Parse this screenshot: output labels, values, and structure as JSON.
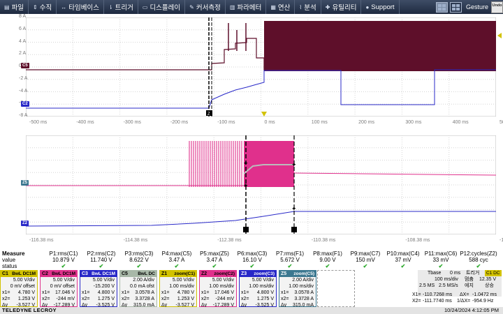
{
  "menu": {
    "items": [
      {
        "icon": "file-icon",
        "glyph": "▤",
        "label": "파일"
      },
      {
        "icon": "vertical-icon",
        "glyph": "⇕",
        "label": "수직"
      },
      {
        "icon": "timebase-icon",
        "glyph": "↔",
        "label": "타임베이스"
      },
      {
        "icon": "trigger-icon",
        "glyph": "⇂",
        "label": "트리거"
      },
      {
        "icon": "display-icon",
        "glyph": "▭",
        "label": "디스플레이"
      },
      {
        "icon": "cursor-icon",
        "glyph": "✎",
        "label": "커서측정"
      },
      {
        "icon": "parameter-icon",
        "glyph": "▥",
        "label": "파라메터"
      },
      {
        "icon": "math-icon",
        "glyph": "▦",
        "label": "연산"
      },
      {
        "icon": "analysis-icon",
        "glyph": "⌇",
        "label": "분석"
      },
      {
        "icon": "utility-icon",
        "glyph": "✚",
        "label": "유틸리티"
      },
      {
        "icon": "support-icon",
        "glyph": "●",
        "label": "Support"
      }
    ],
    "gesture_label": "Gesture",
    "undo_label": "Undo"
  },
  "grid1": {
    "y_labels": [
      "8 A",
      "6 A",
      "4 A",
      "2 A",
      "0 A",
      "-2 A",
      "-4 A",
      "-6 A",
      "-8 A"
    ],
    "x_labels": [
      "-500 ms",
      "-400 ms",
      "-300 ms",
      "-200 ms",
      "-100 ms",
      "0 ms",
      "100 ms",
      "200 ms",
      "300 ms",
      "400 ms",
      "500 ms"
    ],
    "c5_tag": "C5",
    "c2_tag": "C2",
    "cursor_tag": "Z"
  },
  "grid2": {
    "x_labels": [
      "-116.38 ms",
      "-114.38 ms",
      "-112.38 ms",
      "-110.38 ms",
      "-108.38 ms",
      "-106.38 ms"
    ],
    "z5_tag": "Z5",
    "z2_tag": "Z2"
  },
  "measure": {
    "title": "Measure",
    "row_value": "value",
    "row_status": "status",
    "cols": [
      {
        "name": "P1:rms(C1)",
        "value": "10.879 V"
      },
      {
        "name": "P2:rms(C2)",
        "value": "11.740 V"
      },
      {
        "name": "P3:rms(C3)",
        "value": "8.622 V"
      },
      {
        "name": "P4:max(C5)",
        "value": "3.47 A"
      },
      {
        "name": "P5:max(Z5)",
        "value": "3.47 A"
      },
      {
        "name": "P6:max(C3)",
        "value": "16.10 V"
      },
      {
        "name": "P7:rms(F1)",
        "value": "5.672 V"
      },
      {
        "name": "P8:max(F1)",
        "value": "9.00 V"
      },
      {
        "name": "P9:max(C7)",
        "value": "150 mV"
      },
      {
        "name": "P10:max(C4)",
        "value": "37 mV"
      },
      {
        "name": "P11:max(C6)",
        "value": "33 mV"
      },
      {
        "name": "P12:cycles(Z2)",
        "value": "588 cyc"
      }
    ],
    "check": "✔"
  },
  "descriptors": [
    {
      "id": "C1",
      "badge": "BwL DC1M",
      "color": "#d2c200",
      "l1": "5.00 V/div",
      "l2": "0 mV offset",
      "l3": "4.780 V",
      "l4": "1.253 V",
      "l5": "-3.527 V"
    },
    {
      "id": "C2",
      "badge": "BwL DC1M",
      "color": "#e0308c",
      "l1": "5.00 V/div",
      "l2": "0 mV offset",
      "l3": "17.046 V",
      "l4": "-244 mV",
      "l5": "-17.289 V"
    },
    {
      "id": "C3",
      "badge": "BwL DC1M",
      "color": "#2828c8",
      "l1": "5.00 V/div",
      "l2": "-15.200 V",
      "l3": "4.800 V",
      "l4": "1.275 V",
      "l5": "-3.525 V"
    },
    {
      "id": "C5",
      "badge": "BwL DC",
      "color": "#a8b8a8",
      "l1": "2.00 A/div",
      "l2": "0.0 mA ofst",
      "l3": "3.0578 A",
      "l4": "3.3728 A",
      "l5": "315.0 mA"
    },
    {
      "id": "Z1",
      "badge": "zoom(C1)",
      "color": "#d2c200",
      "l1": "5.00 V/div",
      "l2": "1.00 ms/div",
      "l3": "4.780 V",
      "l4": "1.253 V",
      "l5": "-3.527 V"
    },
    {
      "id": "Z2",
      "badge": "zoom(C2)",
      "color": "#e0308c",
      "l1": "5.00 V/div",
      "l2": "1.00 ms/div",
      "l3": "17.046 V",
      "l4": "-244 mV",
      "l5": "-17.289 V"
    },
    {
      "id": "Z3",
      "badge": "zoom(C3)",
      "color": "#2828c8",
      "l1": "5.00 V/div",
      "l2": "1.00 ms/div",
      "l3": "4.800 V",
      "l4": "1.275 V",
      "l5": "-3.525 V"
    },
    {
      "id": "Z5",
      "badge": "zoom(C5)",
      "color": "#3c7890",
      "l1": "2.00 A/div",
      "l2": "1.00 ms/div",
      "l3": "3.0578 A",
      "l4": "3.3728 A",
      "l5": "315.0 mA"
    }
  ],
  "desc_labels": {
    "x1": "x1=",
    "dy": "Δy",
    "x2": "x2="
  },
  "timebase": {
    "title": "Tbase",
    "delay": "0 ms",
    "trigger_title": "트리거",
    "trigger_badge": "C1 DC",
    "div": "100 ms/div",
    "stop": "멈춤",
    "level": "12.35 V",
    "samples": "2.5 MS",
    "rate": "2.5 MS/s",
    "mode": "에지",
    "slope": "상승"
  },
  "cursors": {
    "x1_label": "X1=",
    "x1": "-110.7268 ms",
    "dx_label": "ΔX=",
    "dx": "-1.0472 ms",
    "x2_label": "X2=",
    "x2": "-111.7740 ms",
    "inv_label": "1/ΔX=",
    "inv": "-954.9 Hz"
  },
  "footer": {
    "brand": "TELEDYNE LECROY",
    "datetime": "10/24/2024 4:12:05 PM"
  },
  "colors": {
    "c1": "#d2c200",
    "c2": "#e0308c",
    "c3": "#2828c8",
    "c5": "#5e0f2a",
    "grid": "#cfcfcf"
  }
}
